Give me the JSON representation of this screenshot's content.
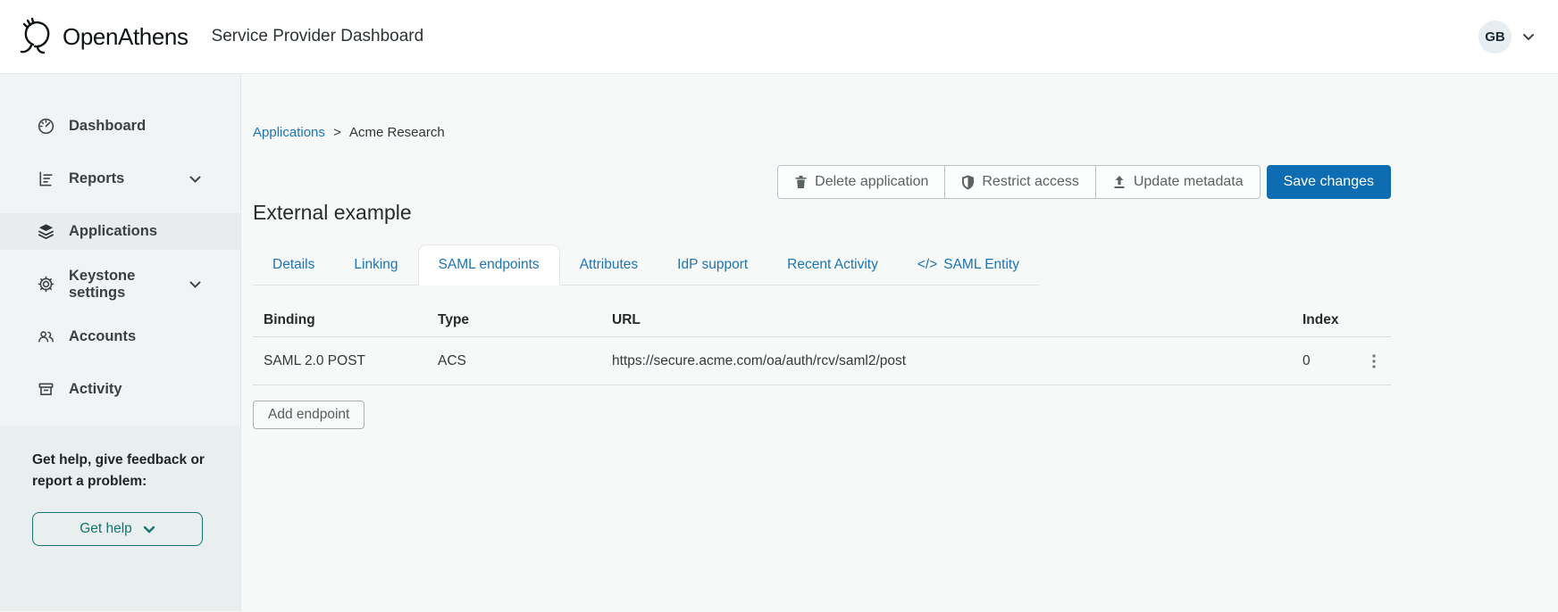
{
  "header": {
    "brand": "OpenAthens",
    "title": "Service Provider Dashboard",
    "avatar_initials": "GB"
  },
  "sidebar": {
    "items": [
      {
        "label": "Dashboard",
        "icon": "dashboard-icon",
        "expandable": false,
        "active": false
      },
      {
        "label": "Reports",
        "icon": "reports-icon",
        "expandable": true,
        "active": false
      },
      {
        "label": "Applications",
        "icon": "applications-icon",
        "expandable": false,
        "active": true
      },
      {
        "label": "Keystone settings",
        "icon": "keystone-settings-icon",
        "expandable": true,
        "active": false
      },
      {
        "label": "Accounts",
        "icon": "accounts-icon",
        "expandable": false,
        "active": false
      },
      {
        "label": "Activity",
        "icon": "activity-icon",
        "expandable": false,
        "active": false
      }
    ],
    "help": {
      "text_line1": "Get help, give feedback or",
      "text_line2": "report a problem:",
      "button_label": "Get help"
    }
  },
  "breadcrumb": {
    "link": "Applications",
    "separator": ">",
    "current": "Acme Research"
  },
  "actions": {
    "delete_label": "Delete application",
    "restrict_label": "Restrict access",
    "update_label": "Update metadata",
    "save_label": "Save changes"
  },
  "page": {
    "title": "External example"
  },
  "tabs": [
    {
      "label": "Details",
      "active": false
    },
    {
      "label": "Linking",
      "active": false
    },
    {
      "label": "SAML endpoints",
      "active": true
    },
    {
      "label": "Attributes",
      "active": false
    },
    {
      "label": "IdP support",
      "active": false
    },
    {
      "label": "Recent Activity",
      "active": false
    },
    {
      "label": "SAML Entity",
      "prefix": "</>",
      "active": false
    }
  ],
  "table": {
    "columns": [
      "Binding",
      "Type",
      "URL",
      "Index"
    ],
    "rows": [
      {
        "binding": "SAML 2.0 POST",
        "type": "ACS",
        "url": "https://secure.acme.com/oa/auth/rcv/saml2/post",
        "index": "0"
      }
    ]
  },
  "add_endpoint_label": "Add endpoint",
  "colors": {
    "link_blue": "#1b74b6",
    "save_blue": "#0e6cb3",
    "teal": "#17756f",
    "sidebar_bg": "#f1f4f4",
    "main_bg": "#f7f9f9"
  }
}
